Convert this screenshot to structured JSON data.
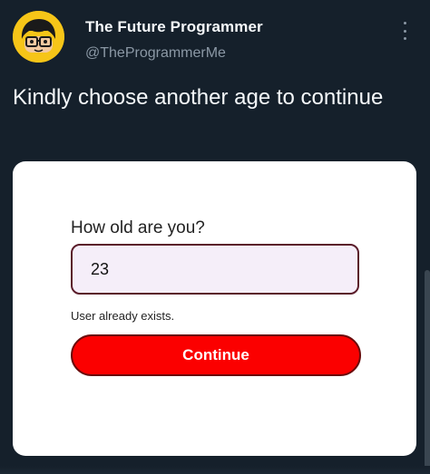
{
  "tweet": {
    "author_name": "The Future Programmer",
    "handle": "@TheProgrammerMe",
    "text": "Kindly choose another age to continue",
    "avatar_icon": "cartoon-programmer-face-icon",
    "more_icon": "more-vertical-icon"
  },
  "form": {
    "question": "How old are you?",
    "age_value": "23",
    "error": "User already exists.",
    "continue_label": "Continue"
  },
  "colors": {
    "background": "#15202b",
    "button": "#fb0000",
    "avatar_bg": "#f6c518"
  }
}
